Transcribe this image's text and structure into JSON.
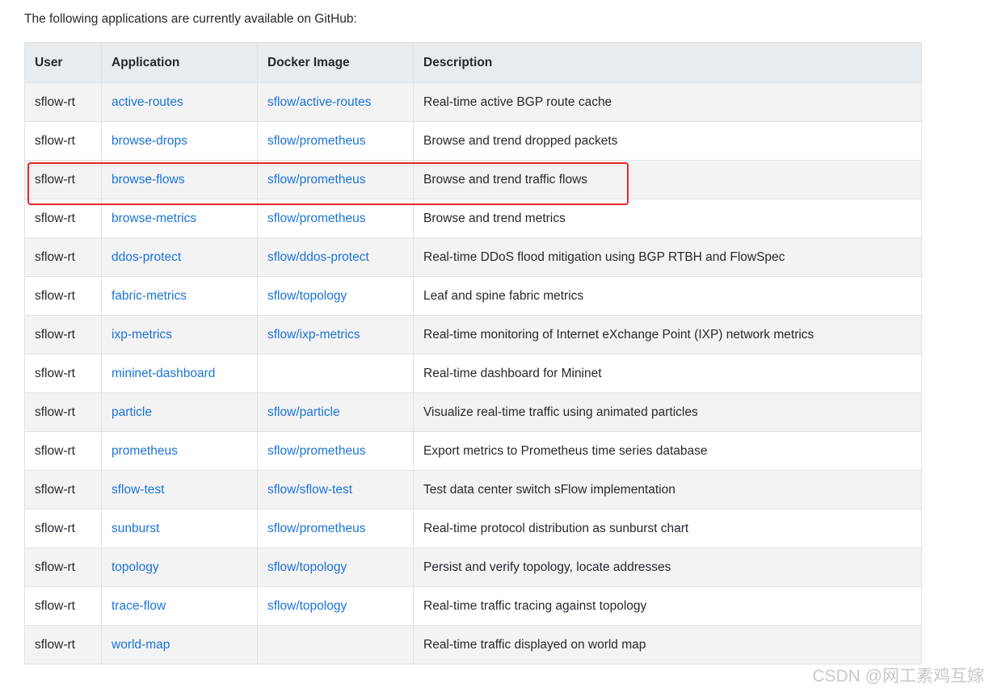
{
  "intro_text": "The following applications are currently available on GitHub:",
  "table": {
    "headers": [
      "User",
      "Application",
      "Docker Image",
      "Description"
    ],
    "rows": [
      {
        "user": "sflow-rt",
        "app": "active-routes",
        "image": "sflow/active-routes",
        "desc": "Real-time active BGP route cache"
      },
      {
        "user": "sflow-rt",
        "app": "browse-drops",
        "image": "sflow/prometheus",
        "desc": "Browse and trend dropped packets"
      },
      {
        "user": "sflow-rt",
        "app": "browse-flows",
        "image": "sflow/prometheus",
        "desc": "Browse and trend traffic flows"
      },
      {
        "user": "sflow-rt",
        "app": "browse-metrics",
        "image": "sflow/prometheus",
        "desc": "Browse and trend metrics"
      },
      {
        "user": "sflow-rt",
        "app": "ddos-protect",
        "image": "sflow/ddos-protect",
        "desc": "Real-time DDoS flood mitigation using BGP RTBH and FlowSpec"
      },
      {
        "user": "sflow-rt",
        "app": "fabric-metrics",
        "image": "sflow/topology",
        "desc": "Leaf and spine fabric metrics"
      },
      {
        "user": "sflow-rt",
        "app": "ixp-metrics",
        "image": "sflow/ixp-metrics",
        "desc": "Real-time monitoring of Internet eXchange Point (IXP) network metrics"
      },
      {
        "user": "sflow-rt",
        "app": "mininet-dashboard",
        "image": "",
        "desc": "Real-time dashboard for Mininet"
      },
      {
        "user": "sflow-rt",
        "app": "particle",
        "image": "sflow/particle",
        "desc": "Visualize real-time traffic using animated particles"
      },
      {
        "user": "sflow-rt",
        "app": "prometheus",
        "image": "sflow/prometheus",
        "desc": "Export metrics to Prometheus time series database"
      },
      {
        "user": "sflow-rt",
        "app": "sflow-test",
        "image": "sflow/sflow-test",
        "desc": "Test data center switch sFlow implementation"
      },
      {
        "user": "sflow-rt",
        "app": "sunburst",
        "image": "sflow/prometheus",
        "desc": "Real-time protocol distribution as sunburst chart"
      },
      {
        "user": "sflow-rt",
        "app": "topology",
        "image": "sflow/topology",
        "desc": "Persist and verify topology, locate addresses"
      },
      {
        "user": "sflow-rt",
        "app": "trace-flow",
        "image": "sflow/topology",
        "desc": "Real-time traffic tracing against topology"
      },
      {
        "user": "sflow-rt",
        "app": "world-map",
        "image": "",
        "desc": "Real-time traffic displayed on world map"
      }
    ]
  },
  "watermark": "CSDN @网工素鸡互嫁",
  "colors": {
    "link": "#1a73d9",
    "header_bg": "#e9ecef",
    "stripe_bg": "#f3f3f3",
    "highlight_border": "#e8262b"
  }
}
